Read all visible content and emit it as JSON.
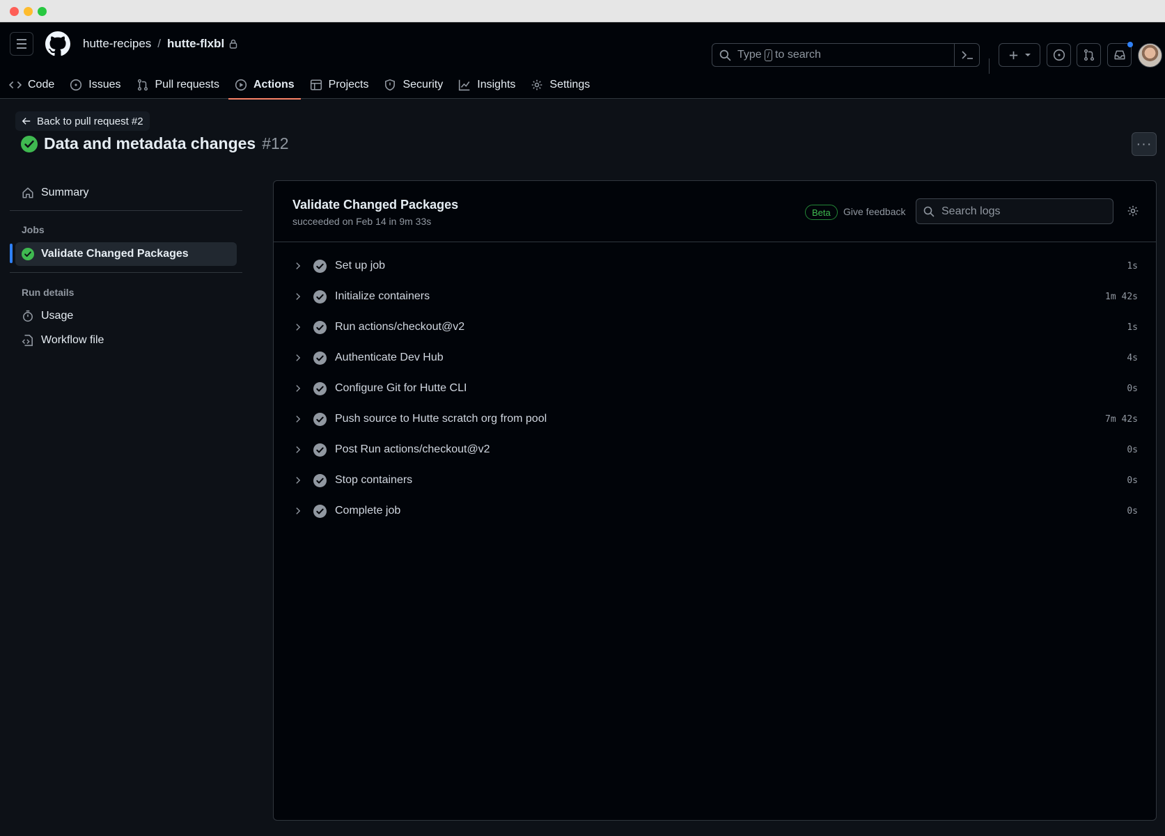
{
  "header": {
    "owner": "hutte-recipes",
    "separator": "/",
    "repo": "hutte-flxbl",
    "search_prefix": "Type",
    "search_key": "/",
    "search_suffix": "to search"
  },
  "tabs": [
    {
      "label": "Code",
      "icon": "code-icon"
    },
    {
      "label": "Issues",
      "icon": "issue-icon"
    },
    {
      "label": "Pull requests",
      "icon": "pull-request-icon"
    },
    {
      "label": "Actions",
      "icon": "play-icon",
      "active": true
    },
    {
      "label": "Projects",
      "icon": "table-icon"
    },
    {
      "label": "Security",
      "icon": "shield-icon"
    },
    {
      "label": "Insights",
      "icon": "graph-icon"
    },
    {
      "label": "Settings",
      "icon": "gear-icon"
    }
  ],
  "run": {
    "back_label": "Back to pull request #2",
    "title": "Data and metadata changes",
    "number": "#12",
    "status": "success"
  },
  "sidebar": {
    "summary": "Summary",
    "jobs_heading": "Jobs",
    "job": "Validate Changed Packages",
    "run_details_heading": "Run details",
    "usage": "Usage",
    "workflow_file": "Workflow file"
  },
  "job": {
    "title": "Validate Changed Packages",
    "subtitle": "succeeded on Feb 14 in 9m 33s",
    "beta": "Beta",
    "feedback": "Give feedback",
    "search_placeholder": "Search logs"
  },
  "steps": [
    {
      "name": "Set up job",
      "duration": "1s"
    },
    {
      "name": "Initialize containers",
      "duration": "1m 42s"
    },
    {
      "name": "Run actions/checkout@v2",
      "duration": "1s"
    },
    {
      "name": "Authenticate Dev Hub",
      "duration": "4s"
    },
    {
      "name": "Configure Git for Hutte CLI",
      "duration": "0s"
    },
    {
      "name": "Push source to Hutte scratch org from pool",
      "duration": "7m 42s"
    },
    {
      "name": "Post Run actions/checkout@v2",
      "duration": "0s"
    },
    {
      "name": "Stop containers",
      "duration": "0s"
    },
    {
      "name": "Complete job",
      "duration": "0s"
    }
  ],
  "colors": {
    "success": "#3fb950",
    "accent_underline": "#f78166",
    "background": "#0d1117"
  }
}
